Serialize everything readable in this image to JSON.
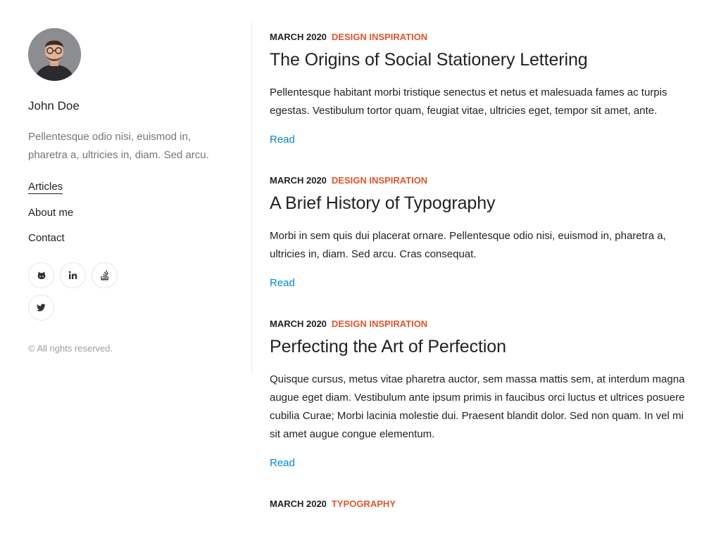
{
  "author": {
    "name": "John Doe",
    "bio": "Pellentesque odio nisi, euismod in, pharetra a, ultricies in, diam. Sed arcu."
  },
  "nav": [
    {
      "label": "Articles",
      "active": true
    },
    {
      "label": "About me",
      "active": false
    },
    {
      "label": "Contact",
      "active": false
    }
  ],
  "social": [
    {
      "icon": "github-icon"
    },
    {
      "icon": "linkedin-icon"
    },
    {
      "icon": "stackoverflow-icon"
    },
    {
      "icon": "twitter-icon"
    }
  ],
  "copyright": "© All rights reserved.",
  "articles": [
    {
      "date": "March 2020",
      "category": "Design Inspiration",
      "title": "The Origins of Social Stationery Lettering",
      "excerpt": "Pellentesque habitant morbi tristique senectus et netus et malesuada fames ac turpis egestas. Vestibulum tortor quam, feugiat vitae, ultricies eget, tempor sit amet, ante.",
      "read_label": "Read"
    },
    {
      "date": "March 2020",
      "category": "Design Inspiration",
      "title": "A Brief History of Typography",
      "excerpt": "Morbi in sem quis dui placerat ornare. Pellentesque odio nisi, euismod in, pharetra a, ultricies in, diam. Sed arcu. Cras consequat.",
      "read_label": "Read"
    },
    {
      "date": "March 2020",
      "category": "Design Inspiration",
      "title": "Perfecting the Art of Perfection",
      "excerpt": "Quisque cursus, metus vitae pharetra auctor, sem massa mattis sem, at interdum magna augue eget diam. Vestibulum ante ipsum primis in faucibus orci luctus et ultrices posuere cubilia Curae; Morbi lacinia molestie dui. Praesent blandit dolor. Sed non quam. In vel mi sit amet augue congue elementum.",
      "read_label": "Read"
    },
    {
      "date": "March 2020",
      "category": "Typography",
      "title": "",
      "excerpt": "",
      "read_label": ""
    }
  ],
  "colors": {
    "accent": "#e0542d",
    "link": "#0288d1",
    "text": "#222222",
    "muted": "#757575"
  }
}
